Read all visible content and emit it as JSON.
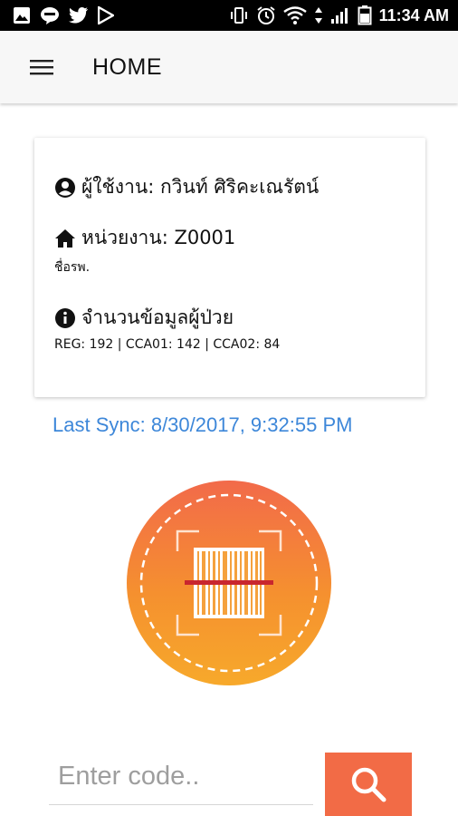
{
  "status_bar": {
    "time": "11:34 AM",
    "left_icons": [
      "gallery-icon",
      "line-chat-icon",
      "twitter-icon",
      "play-store-icon"
    ],
    "right_icons": [
      "vibrate-icon",
      "alarm-icon",
      "wifi-icon",
      "data-arrows-icon",
      "signal-icon",
      "battery-icon"
    ]
  },
  "app_bar": {
    "menu_icon": "hamburger-menu-icon",
    "title": "HOME"
  },
  "info_card": {
    "user": {
      "icon": "account-circle-icon",
      "text": "ผู้ใช้งาน: กวินท์ ศิริคะเณรัตน์"
    },
    "unit": {
      "icon": "home-icon",
      "text": "หน่วยงาน: Z0001",
      "subtext": "ชื่อรพ."
    },
    "patients": {
      "icon": "info-icon",
      "text": "จำนวนข้อมูลผู้ป่วย",
      "subtext": "REG: 192 | CCA01: 142 | CCA02: 84"
    }
  },
  "sync": {
    "text": "Last Sync: 8/30/2017, 9:32:55 PM"
  },
  "scan": {
    "icon": "barcode-scan-icon"
  },
  "code_entry": {
    "placeholder": "Enter code..",
    "value": "",
    "search_icon": "search-icon"
  },
  "colors": {
    "accent": "#f26b46",
    "link_blue": "#3d87d9",
    "scan_gradient_top": "#f26a4a",
    "scan_gradient_bottom": "#f7a92b",
    "scan_line": "#c8262e"
  }
}
